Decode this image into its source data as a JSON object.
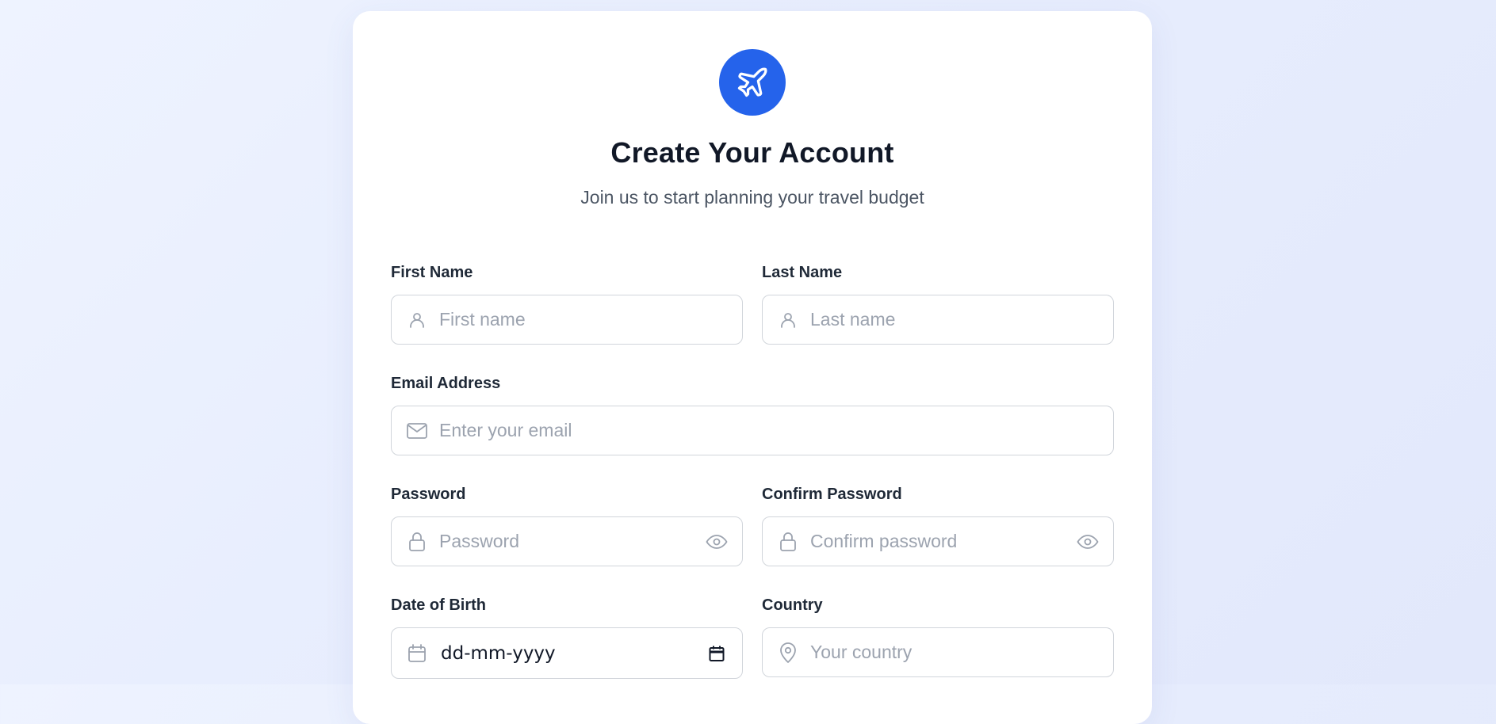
{
  "header": {
    "title": "Create Your Account",
    "subtitle": "Join us to start planning your travel budget",
    "logo_icon": "plane-icon"
  },
  "colors": {
    "accent": "#2563eb",
    "title": "#111827",
    "placeholder": "#9ca3af",
    "border": "#d1d5db"
  },
  "form": {
    "first_name": {
      "label": "First Name",
      "placeholder": "First name",
      "value": "",
      "icon": "user-icon"
    },
    "last_name": {
      "label": "Last Name",
      "placeholder": "Last name",
      "value": "",
      "icon": "user-icon"
    },
    "email": {
      "label": "Email Address",
      "placeholder": "Enter your email",
      "value": "",
      "icon": "mail-icon"
    },
    "password": {
      "label": "Password",
      "placeholder": "Password",
      "value": "",
      "icon": "lock-icon",
      "toggle_icon": "eye-icon"
    },
    "confirm_password": {
      "label": "Confirm Password",
      "placeholder": "Confirm password",
      "value": "",
      "icon": "lock-icon",
      "toggle_icon": "eye-icon"
    },
    "dob": {
      "label": "Date of Birth",
      "display": "dd-mm-yyyy",
      "icon": "calendar-icon",
      "picker_icon": "calendar-picker-icon"
    },
    "country": {
      "label": "Country",
      "placeholder": "Your country",
      "value": "",
      "icon": "map-pin-icon"
    }
  }
}
